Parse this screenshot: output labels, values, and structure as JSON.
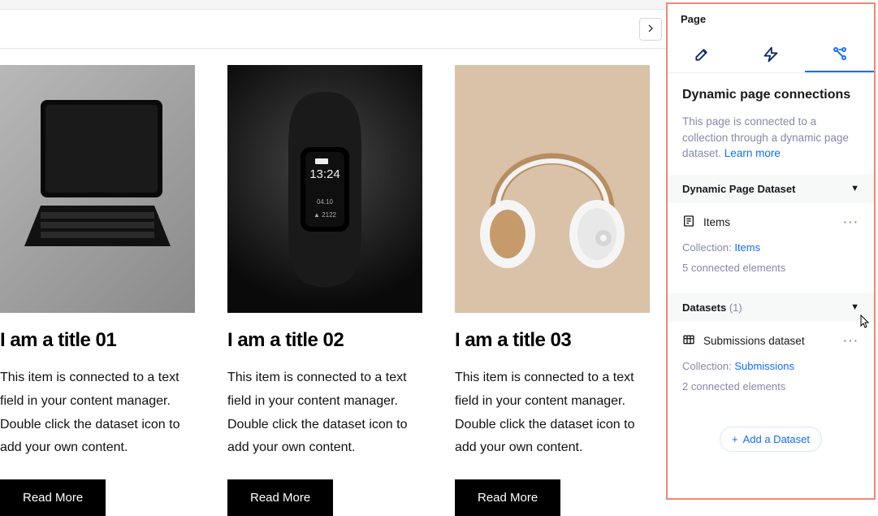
{
  "cards": [
    {
      "title": "I am a title 01",
      "desc": "This item is connected to a text field in your content manager. Double click the dataset icon to add your own content.",
      "cta": "Read More"
    },
    {
      "title": "I am a title 02",
      "desc": "This item is connected to a text field in your content manager. Double click the dataset icon to add your own content.",
      "cta": "Read More"
    },
    {
      "title": "I am a title 03",
      "desc": "This item is connected to a text field in your content manager. Double click the dataset icon to add your own content.",
      "cta": "Read More"
    }
  ],
  "panel": {
    "header": "Page",
    "heading": "Dynamic page connections",
    "intro": "This page is connected to a collection through a dynamic page dataset. ",
    "learn_more": "Learn more",
    "group1": {
      "title": "Dynamic Page Dataset",
      "dataset_name": "Items",
      "collection_label": "Collection:",
      "collection_value": "Items",
      "connected": "5 connected elements"
    },
    "group2": {
      "title": "Datasets",
      "count": "(1)",
      "dataset_name": "Submissions dataset",
      "collection_label": "Collection:",
      "collection_value": "Submissions",
      "connected": "2 connected elements"
    },
    "add_label": "Add a Dataset"
  }
}
